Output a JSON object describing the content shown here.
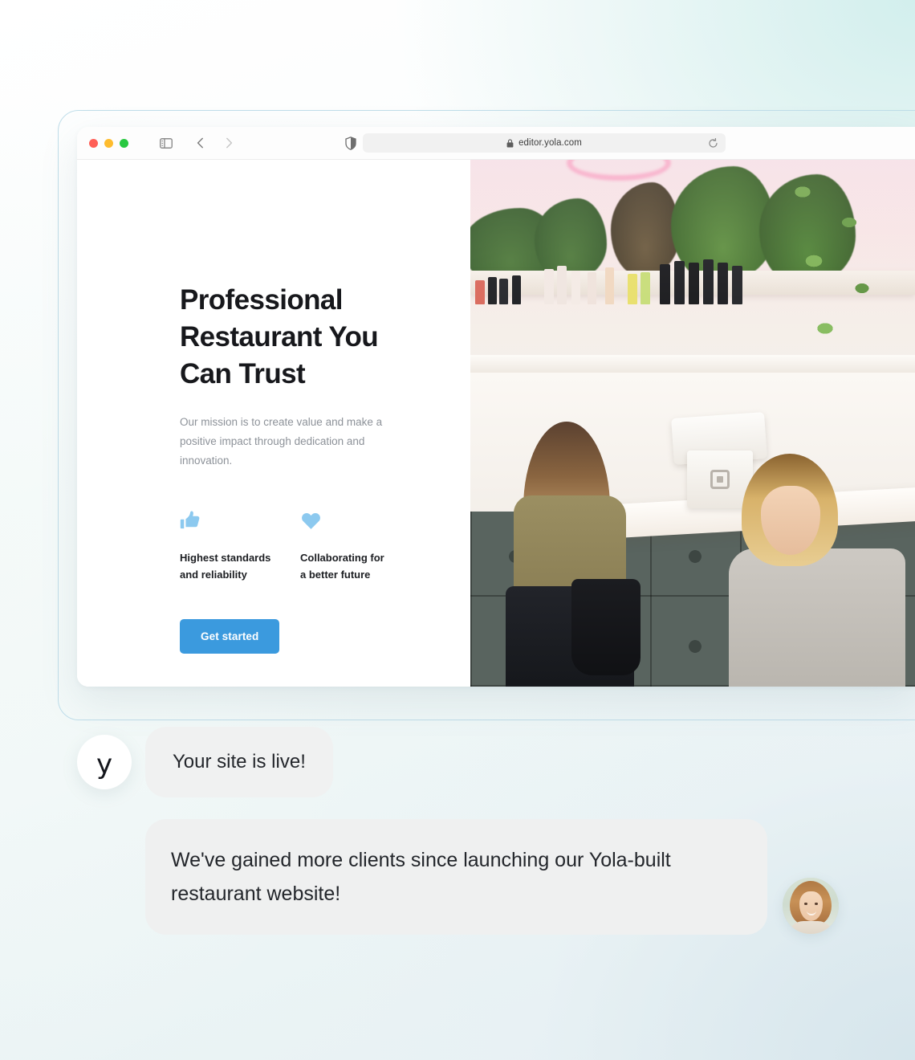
{
  "browser": {
    "traffic_lights": [
      "close",
      "minimize",
      "maximize"
    ],
    "colors": {
      "close": "#ff5f57",
      "minimize": "#febc2e",
      "maximize": "#28c840"
    },
    "sidebar_toggle": "sidebar-toggle-icon",
    "back": "back-chevron-icon",
    "forward": "forward-chevron-icon",
    "shield": "shield-privacy-icon",
    "url": "editor.yola.com",
    "lock": "lock-icon",
    "reload": "reload-icon"
  },
  "site": {
    "hero": {
      "title": "Professional Restaurant You Can Trust",
      "subtitle": "Our mission is to create value and make a positive impact through dedication and innovation.",
      "cta_label": "Get started",
      "cta_color": "#3b9ade",
      "accent_color": "#8cc9ef",
      "features": [
        {
          "icon": "thumbs-up-icon",
          "label": "Highest standards\nand reliability"
        },
        {
          "icon": "heart-icon",
          "label": "Collaborating for\na better future"
        }
      ]
    },
    "photo_alt": "two women at a salon counter with plants"
  },
  "chat": {
    "brand_initial": "y",
    "messages": [
      {
        "author": "yola",
        "text": "Your site is live!"
      },
      {
        "author": "customer",
        "text": "We've gained more clients since launching our Yola-built restaurant website!"
      }
    ],
    "customer_avatar": "smiling-woman-avatar"
  }
}
